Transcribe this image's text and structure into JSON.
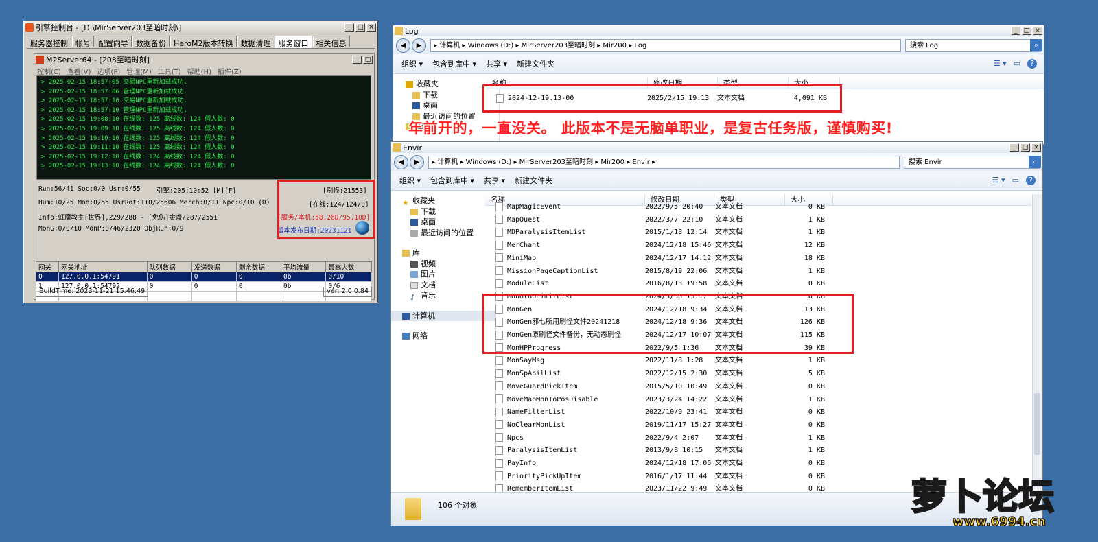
{
  "engine": {
    "title": "引擎控制台 - [D:\\MirServer203至暗时刻\\]",
    "tabs": [
      "服务器控制",
      "帐号",
      "配置向导",
      "数据备份",
      "HeroM2版本转换",
      "数据清理",
      "服务窗口",
      "相关信息"
    ],
    "active_tab": 6,
    "inner_title": "M2Server64 - [203至暗时刻]",
    "menu": [
      "控制(C)",
      "查看(V)",
      "选项(P)",
      "管理(M)",
      "工具(T)",
      "帮助(H)",
      "插件(Z)"
    ],
    "log": [
      "> 2025-02-15 18:57:05 交易NPC重新加载成功.",
      "> 2025-02-15 18:57:06 管理NPC重新加载成功.",
      "> 2025-02-15 18:57:10 交易NPC重新加载成功.",
      "> 2025-02-15 18:57:10 管理NPC重新加载成功.",
      "> 2025-02-15 19:08:10 在线数: 125 离线数: 124 假人数: 0",
      "> 2025-02-15 19:09:10 在线数: 125 离线数: 124 假人数: 0",
      "> 2025-02-15 19:10:10 在线数: 125 离线数: 124 假人数: 0",
      "> 2025-02-15 19:11:10 在线数: 125 离线数: 124 假人数: 0",
      "> 2025-02-15 19:12:10 在线数: 124 离线数: 124 假人数: 0",
      "> 2025-02-15 19:13:10 在线数: 124 离线数: 124 假人数: 0"
    ],
    "stats": {
      "run": "Run:56/41 Soc:0/0 Usr:0/55",
      "engine": "引擎:205:10:52 [M][F]",
      "refresh": "[刷怪:21553]",
      "hum": "Hum:10/25 Mon:0/55 UsrRot:110/25606 Merch:0/11 Npc:0/10 (D)",
      "online": "[在线:124/124/0]",
      "info": "Info:虹魔教主[世界],229/288 - [免伤]金盏/287/2551",
      "service": "[服务/本机:58.26D/95.10D]",
      "mong": "MonG:0/0/10 MonP:0/46/2320 ObjRun:0/9",
      "release_label": "版本发布日期:",
      "release_date": "20231121"
    },
    "gateway": {
      "headers": [
        "网关",
        "网关地址",
        "队列数据",
        "发送数据",
        "剩余数据",
        "平均流量",
        "最高人数"
      ],
      "rows": [
        [
          "0",
          "127.0.0.1:54791",
          "0",
          "0",
          "0",
          "0b",
          "0/10"
        ],
        [
          "1",
          "127.0.0.1:54792",
          "0",
          "0",
          "0",
          "0b",
          "0/6"
        ]
      ]
    },
    "build_time": "BuildTime: 2023-11-21 15:46:49",
    "version": "ver: 2.0.0.84"
  },
  "log_window": {
    "title": "Log",
    "path": "▸ 计算机 ▸ Windows (D:) ▸ MirServer203至暗时刻 ▸ Mir200 ▸ Log",
    "search_placeholder": "搜索 Log",
    "toolbar": [
      "组织 ▾",
      "包含到库中 ▾",
      "共享 ▾",
      "新建文件夹"
    ],
    "nav": [
      "收藏夹",
      "下载",
      "桌面",
      "最近访问的位置",
      "库"
    ],
    "columns": [
      "名称",
      "修改日期",
      "类型",
      "大小"
    ],
    "file": {
      "name": "2024-12-19.13-00",
      "date": "2025/2/15 19:13",
      "type": "文本文档",
      "size": "4,091 KB"
    }
  },
  "caption": "年前开的，一直没关。 此版本不是无脑单职业，是复古任务版，谨慎购买!",
  "envir_window": {
    "title": "Envir",
    "path": "▸ 计算机 ▸ Windows (D:) ▸ MirServer203至暗时刻 ▸ Mir200 ▸ Envir ▸",
    "search_placeholder": "搜索 Envir",
    "toolbar": [
      "组织 ▾",
      "包含到库中 ▾",
      "共享 ▾",
      "新建文件夹"
    ],
    "nav": {
      "favorites": "收藏夹",
      "downloads": "下载",
      "desktop": "桌面",
      "recent": "最近访问的位置",
      "libraries": "库",
      "videos": "视频",
      "pictures": "图片",
      "documents": "文档",
      "music": "音乐",
      "computer": "计算机",
      "network": "网络"
    },
    "columns": [
      "名称",
      "修改日期",
      "类型",
      "大小"
    ],
    "files": [
      [
        "MapMagicEvent",
        "2022/9/5 20:40",
        "文本文档",
        "0 KB"
      ],
      [
        "MapQuest",
        "2022/3/7 22:10",
        "文本文档",
        "1 KB"
      ],
      [
        "MDParalysisItemList",
        "2015/1/18 12:14",
        "文本文档",
        "1 KB"
      ],
      [
        "MerChant",
        "2024/12/18 15:46",
        "文本文档",
        "12 KB"
      ],
      [
        "MiniMap",
        "2024/12/17 14:12",
        "文本文档",
        "18 KB"
      ],
      [
        "MissionPageCaptionList",
        "2015/8/19 22:06",
        "文本文档",
        "1 KB"
      ],
      [
        "ModuleList",
        "2016/8/13 19:58",
        "文本文档",
        "0 KB"
      ],
      [
        "MonDropLimitList",
        "2024/5/30 13:17",
        "文本文档",
        "0 KB"
      ],
      [
        "MonGen",
        "2024/12/18 9:34",
        "文本文档",
        "13 KB"
      ],
      [
        "MonGen邪七所用刷怪文件20241218",
        "2024/12/18 9:36",
        "文本文档",
        "126 KB"
      ],
      [
        "MonGen原刷怪文件备份，无动态刷怪",
        "2024/12/17 10:07",
        "文本文档",
        "115 KB"
      ],
      [
        "MonHPProgress",
        "2022/9/5 1:36",
        "文本文档",
        "39 KB"
      ],
      [
        "MonSayMsg",
        "2022/11/8 1:28",
        "文本文档",
        "1 KB"
      ],
      [
        "MonSpAbilList",
        "2022/12/15 2:30",
        "文本文档",
        "5 KB"
      ],
      [
        "MoveGuardPickItem",
        "2015/5/10 10:49",
        "文本文档",
        "0 KB"
      ],
      [
        "MoveMapMonToPosDisable",
        "2023/3/24 14:22",
        "文本文档",
        "1 KB"
      ],
      [
        "NameFilterList",
        "2022/10/9 23:41",
        "文本文档",
        "0 KB"
      ],
      [
        "NoClearMonList",
        "2019/11/17 15:27",
        "文本文档",
        "0 KB"
      ],
      [
        "Npcs",
        "2022/9/4 2:07",
        "文本文档",
        "1 KB"
      ],
      [
        "ParalysisItemList",
        "2013/9/8 10:15",
        "文本文档",
        "1 KB"
      ],
      [
        "PayInfo",
        "2024/12/18 17:06",
        "文本文档",
        "0 KB"
      ],
      [
        "PriorityPickUpItem",
        "2016/1/17 11:44",
        "文本文档",
        "0 KB"
      ],
      [
        "RememberItemList",
        "2023/11/22 9:49",
        "文本文档",
        "0 KB"
      ]
    ],
    "object_count": "106 个对象"
  },
  "watermark": {
    "brand": "萝卜论坛",
    "url": "www.6994.cn"
  },
  "colors": {
    "desktop": "#3a6ea5",
    "console_bg": "#0b1710",
    "console_text": "#2ee84d",
    "highlight": "#e02020",
    "selection": "#0a246a"
  }
}
